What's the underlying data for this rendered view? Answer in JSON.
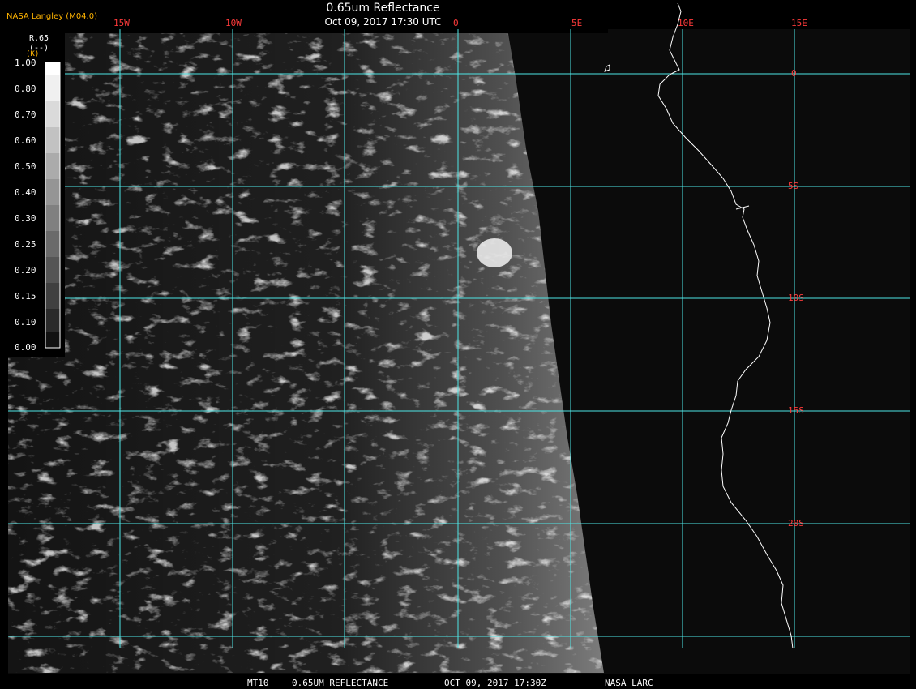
{
  "header": {
    "brand": "NASA Langley (M04.0)",
    "title": "0.65um Reflectance",
    "datetime": "Oct 09, 2017 17:30 UTC"
  },
  "map": {
    "longitude_labels": [
      "15W",
      "10W",
      "0",
      "5E",
      "10E",
      "15E"
    ],
    "latitude_labels": [
      "0",
      "5S",
      "10S",
      "15S",
      "20S"
    ],
    "grid_color": "#4ee6e6",
    "label_color": "#ff3b3b",
    "coastline_color": "#ffffff"
  },
  "legend": {
    "product": "R.65",
    "units": "(--)",
    "marker": "(K)",
    "values": [
      "1.00",
      "0.80",
      "0.70",
      "0.60",
      "0.50",
      "0.40",
      "0.30",
      "0.25",
      "0.20",
      "0.15",
      "0.10",
      "0.00"
    ]
  },
  "footer": {
    "sat": "MT10",
    "product": "0.65UM REFLECTANCE",
    "datetime": "OCT 09, 2017 17:30Z",
    "org": "NASA LARC"
  }
}
